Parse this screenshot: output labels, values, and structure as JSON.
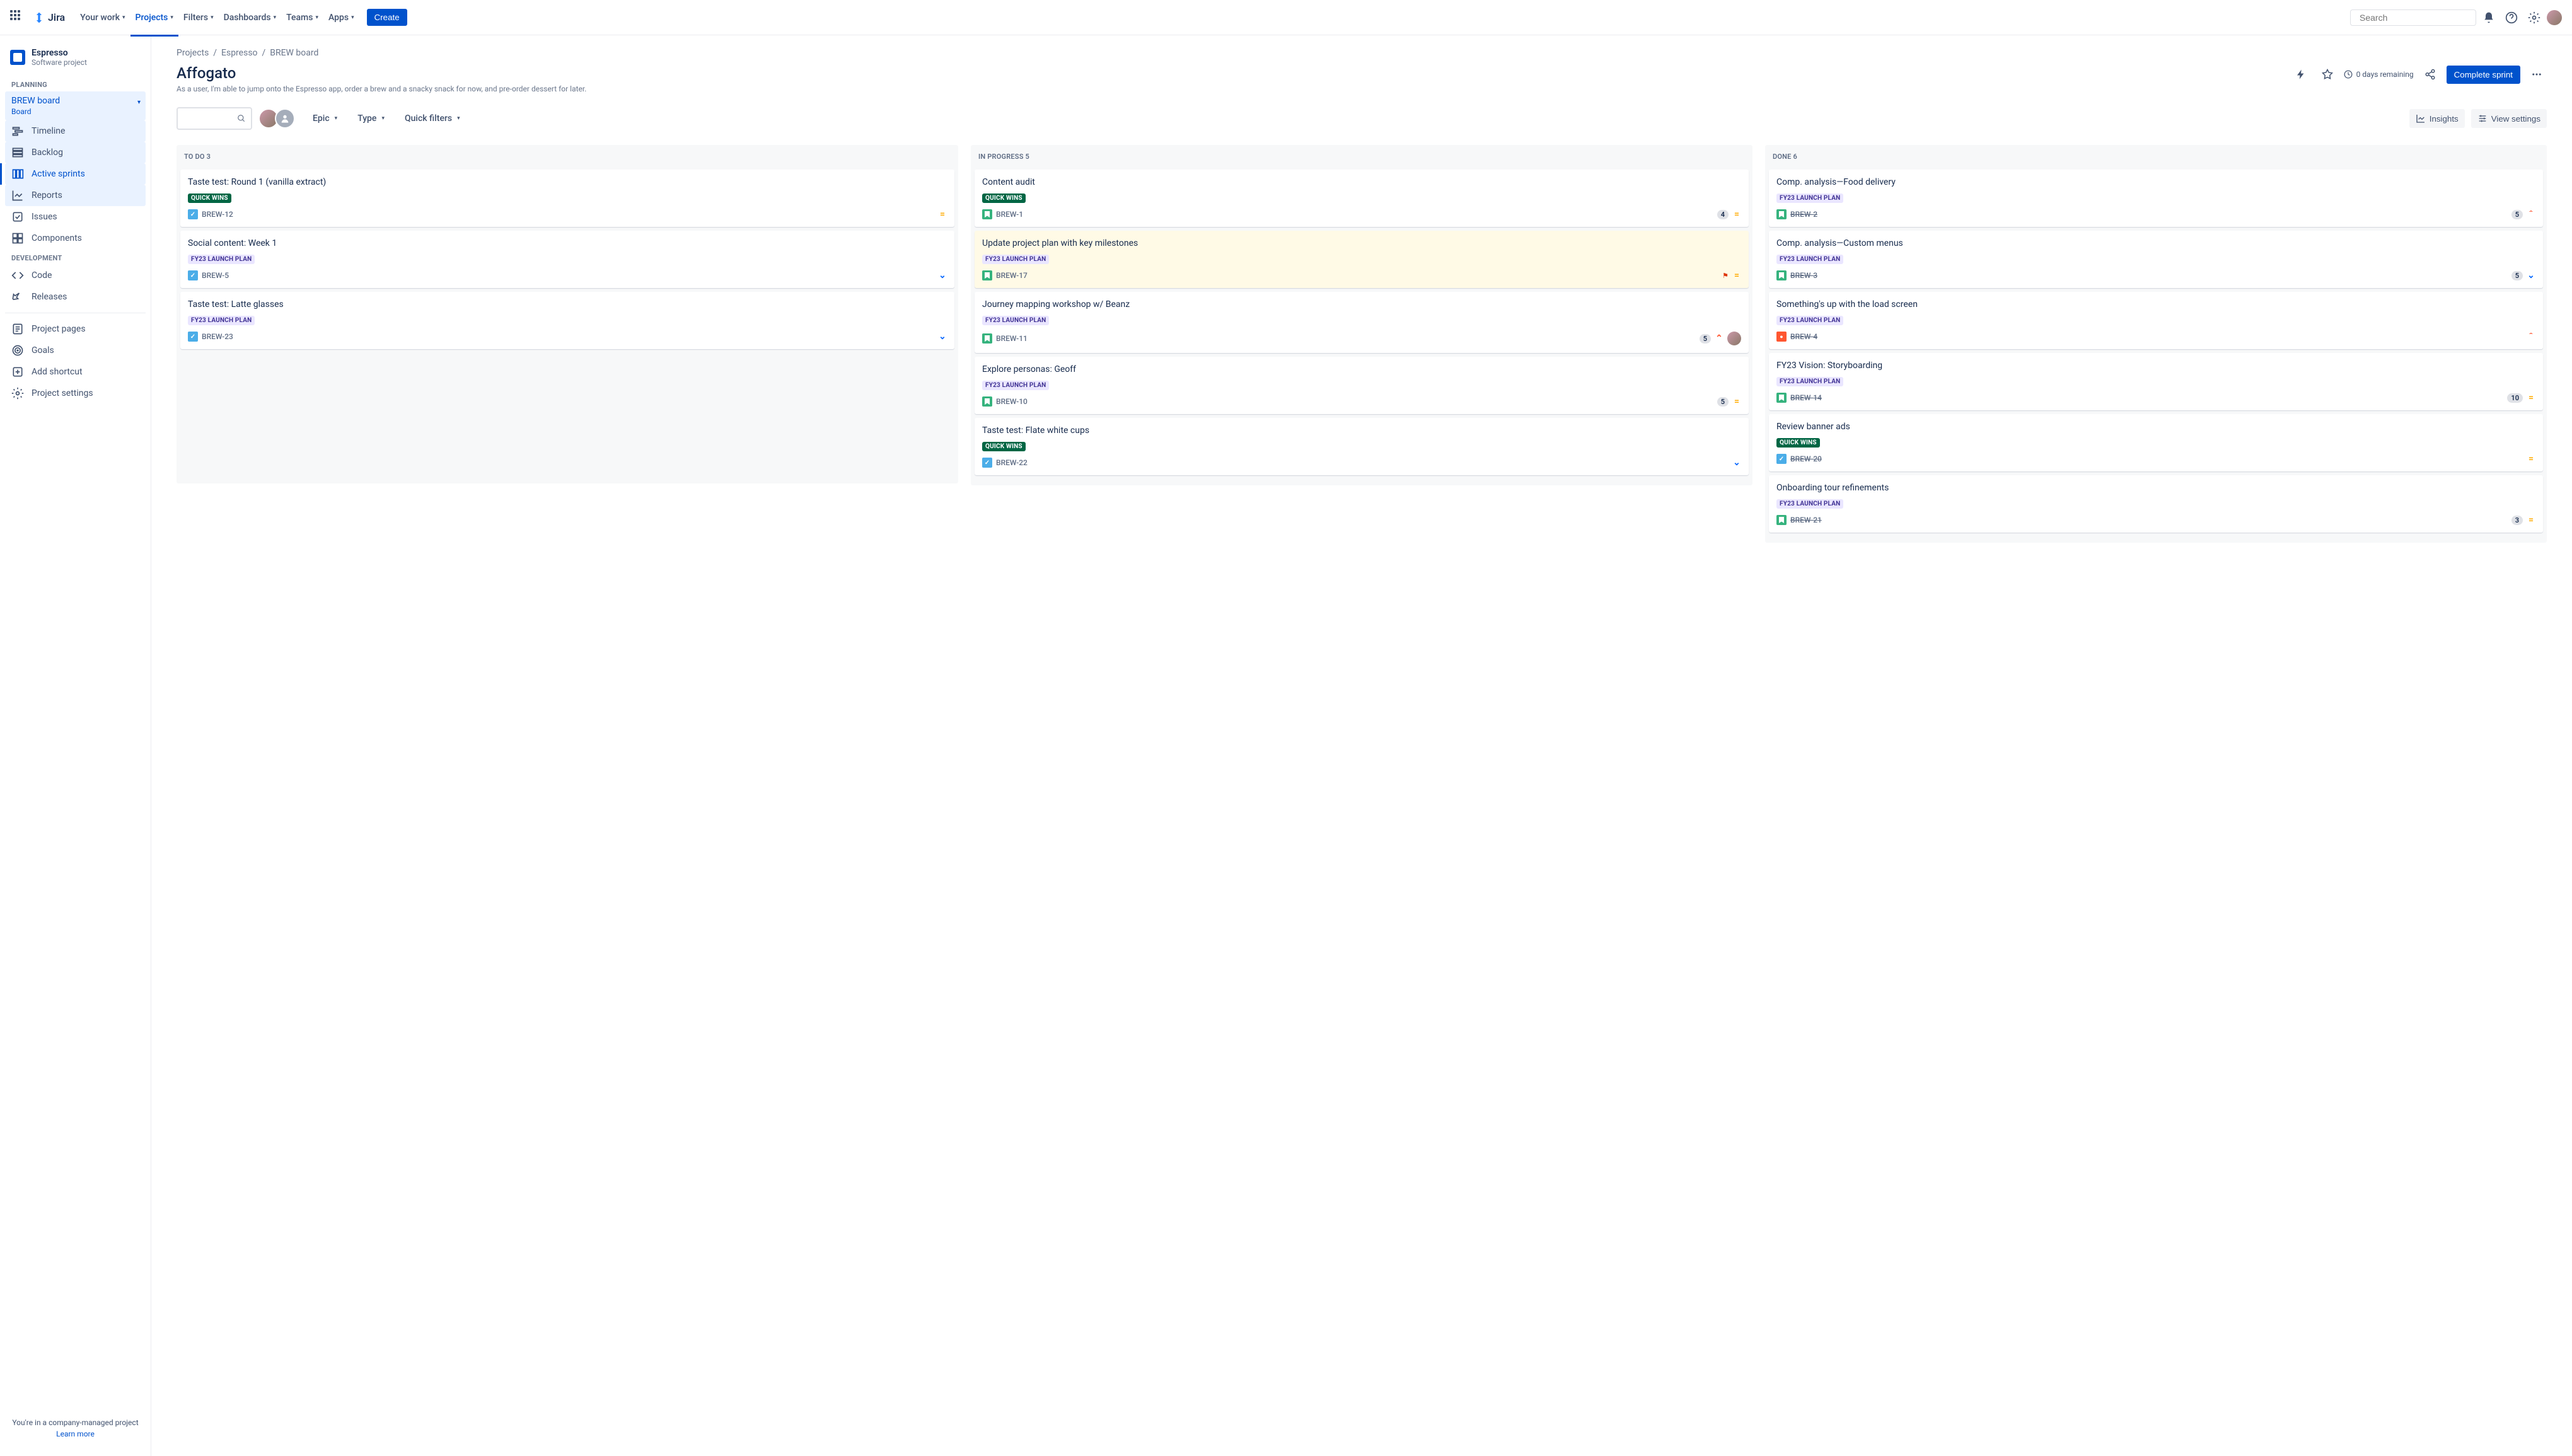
{
  "nav": {
    "logo": "Jira",
    "items": [
      "Your work",
      "Projects",
      "Filters",
      "Dashboards",
      "Teams",
      "Apps"
    ],
    "active_index": 1,
    "create": "Create",
    "search_placeholder": "Search"
  },
  "project": {
    "name": "Espresso",
    "type": "Software project"
  },
  "sidebar": {
    "sections": {
      "planning": "PLANNING",
      "development": "DEVELOPMENT"
    },
    "board": {
      "name": "BREW board",
      "sub": "Board"
    },
    "planning_items": [
      "Timeline",
      "Backlog",
      "Active sprints",
      "Reports"
    ],
    "active_planning_index": 2,
    "other_items": [
      "Issues",
      "Components"
    ],
    "dev_items": [
      "Code",
      "Releases"
    ],
    "bottom_items": [
      "Project pages",
      "Goals",
      "Add shortcut",
      "Project settings"
    ],
    "footer": {
      "text": "You're in a company-managed project",
      "link": "Learn more"
    }
  },
  "breadcrumb": [
    "Projects",
    "Espresso",
    "BREW board"
  ],
  "header": {
    "title": "Affogato",
    "subtitle": "As a user, I'm able to jump onto the Espresso app, order a brew and a snacky snack for now, and pre-order dessert for later.",
    "days": "0 days remaining",
    "complete": "Complete sprint"
  },
  "toolbar": {
    "filters": [
      "Epic",
      "Type",
      "Quick filters"
    ],
    "insights": "Insights",
    "view_settings": "View settings"
  },
  "labels": {
    "quick": "QUICK WINS",
    "launch": "FY23 LAUNCH PLAN"
  },
  "columns": [
    {
      "name": "TO DO",
      "count": 3,
      "cards": [
        {
          "title": "Taste test: Round 1 (vanilla extract)",
          "label": "quick",
          "type": "task",
          "key": "BREW-12",
          "priority": "med"
        },
        {
          "title": "Social content: Week 1",
          "label": "launch",
          "type": "task",
          "key": "BREW-5",
          "priority": "low"
        },
        {
          "title": "Taste test: Latte glasses",
          "label": "launch",
          "type": "task",
          "key": "BREW-23",
          "priority": "low"
        }
      ]
    },
    {
      "name": "IN PROGRESS",
      "count": 5,
      "cards": [
        {
          "title": "Content audit",
          "label": "quick",
          "type": "story",
          "key": "BREW-1",
          "priority": "med",
          "estimate": 4
        },
        {
          "title": "Update project plan with key milestones",
          "label": "launch",
          "type": "story",
          "key": "BREW-17",
          "priority": "med",
          "flagged": true
        },
        {
          "title": "Journey mapping workshop w/ Beanz",
          "label": "launch",
          "type": "story",
          "key": "BREW-11",
          "priority": "high",
          "estimate": 5,
          "assignee": true
        },
        {
          "title": "Explore personas: Geoff",
          "label": "launch",
          "type": "story",
          "key": "BREW-10",
          "priority": "med",
          "estimate": 5
        },
        {
          "title": "Taste test: Flate white cups",
          "label": "quick",
          "type": "task",
          "key": "BREW-22",
          "priority": "low"
        }
      ]
    },
    {
      "name": "DONE",
      "count": 6,
      "cards": [
        {
          "title": "Comp. analysis—Food delivery",
          "label": "launch",
          "type": "story",
          "key": "BREW-2",
          "priority": "highest",
          "estimate": 5,
          "done": true
        },
        {
          "title": "Comp. analysis—Custom menus",
          "label": "launch",
          "type": "story",
          "key": "BREW-3",
          "priority": "low",
          "estimate": 5,
          "done": true
        },
        {
          "title": "Something's up with the load screen",
          "label": "launch",
          "type": "bug",
          "key": "BREW-4",
          "priority": "highest",
          "done": true
        },
        {
          "title": "FY23 Vision: Storyboarding",
          "label": "launch",
          "type": "story",
          "key": "BREW-14",
          "priority": "med",
          "estimate": 10,
          "done": true
        },
        {
          "title": "Review banner ads",
          "label": "quick",
          "type": "task",
          "key": "BREW-20",
          "priority": "med",
          "done": true
        },
        {
          "title": "Onboarding tour refinements",
          "label": "launch",
          "type": "story",
          "key": "BREW-21",
          "priority": "med",
          "estimate": 3,
          "done": true
        }
      ]
    }
  ]
}
